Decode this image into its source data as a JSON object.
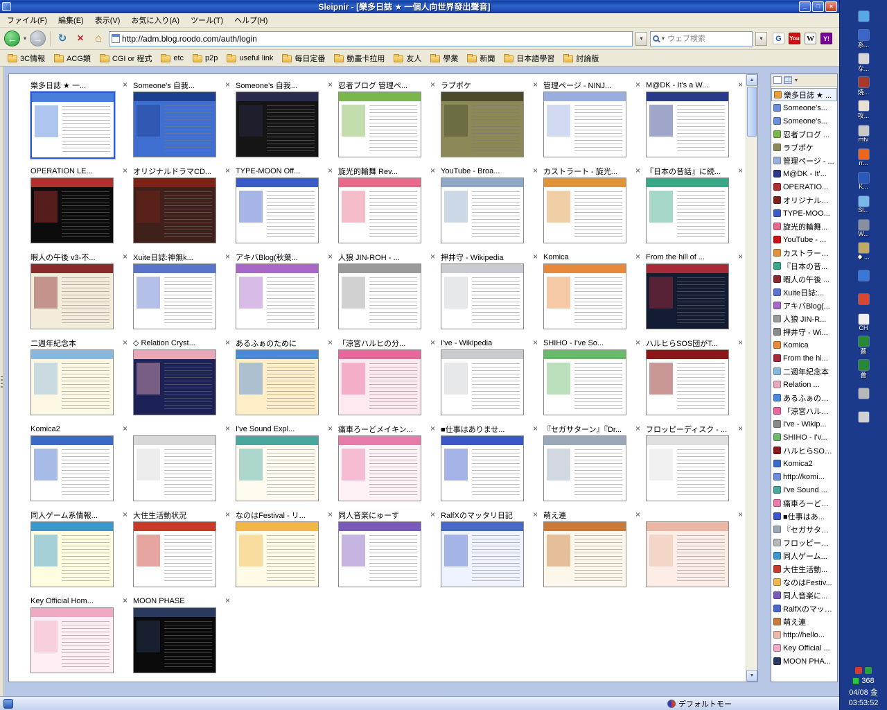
{
  "icons": {
    "close": "×",
    "caret": "▾",
    "back": "←",
    "forward": "→",
    "refresh": "↻",
    "stop": "×",
    "home": "⌂",
    "minimize": "_",
    "maximize": "□",
    "close_win": "×",
    "up": "▲",
    "down": "▼",
    "google": "G",
    "youtube": "You",
    "wikipedia": "W",
    "yahoo": "Y!"
  },
  "titlebar": {
    "title": "Sleipnir - [樂多日誌 ★ 一個人向世界發出聲音]"
  },
  "menu": {
    "items": [
      {
        "label": "ファイル(F)"
      },
      {
        "label": "編集(E)"
      },
      {
        "label": "表示(V)"
      },
      {
        "label": "お気に入り(A)"
      },
      {
        "label": "ツール(T)"
      },
      {
        "label": "ヘルプ(H)"
      }
    ]
  },
  "toolbar": {
    "address": "http://adm.blog.roodo.com/auth/login",
    "search_placeholder": "ウェブ検索"
  },
  "linksbar": {
    "items": [
      {
        "label": "3C情報"
      },
      {
        "label": "ACG類"
      },
      {
        "label": "CGI or 程式"
      },
      {
        "label": "etc"
      },
      {
        "label": "p2p"
      },
      {
        "label": "useful link"
      },
      {
        "label": "每日定番"
      },
      {
        "label": "動畫卡拉用"
      },
      {
        "label": "友人"
      },
      {
        "label": "學業"
      },
      {
        "label": "新聞"
      },
      {
        "label": "日本語學習"
      },
      {
        "label": "討論版"
      }
    ]
  },
  "thumbs": [
    {
      "title": "樂多日誌 ★ 一...",
      "c1": "#ffffff",
      "c2": "#4a7edb",
      "sel": true
    },
    {
      "title": "Someone's 自我...",
      "c1": "#3f6fd0",
      "c2": "#1d3f8f"
    },
    {
      "title": "Someone's 自我...",
      "c1": "#151515",
      "c2": "#2a2a4a"
    },
    {
      "title": "忍者ブログ 管理ペ...",
      "c1": "#ffffff",
      "c2": "#7ab648"
    },
    {
      "title": "ラブポケ",
      "c1": "#8a8a58",
      "c2": "#4a4a2a"
    },
    {
      "title": "管理ページ - NINJ...",
      "c1": "#ffffff",
      "c2": "#9aaede"
    },
    {
      "title": "M@DK - It's a W...",
      "c1": "#ffffff",
      "c2": "#2a3a8a"
    },
    {
      "title": "OPERATION LE...",
      "c1": "#0c0c0c",
      "c2": "#b03030"
    },
    {
      "title": "オリジナルドラマCD...",
      "c1": "#40201a",
      "c2": "#7a2418"
    },
    {
      "title": "TYPE-MOON Off...",
      "c1": "#ffffff",
      "c2": "#3a5cc8"
    },
    {
      "title": "旋光的輪舞 Rev...",
      "c1": "#ffffff",
      "c2": "#e86a8a"
    },
    {
      "title": "YouTube - Broa...",
      "c1": "#ffffff",
      "c2": "#90a8c8"
    },
    {
      "title": "カストラート - 旋光...",
      "c1": "#ffffff",
      "c2": "#e0943a"
    },
    {
      "title": "『日本の昔話』に続...",
      "c1": "#ffffff",
      "c2": "#3aa888"
    },
    {
      "title": "暇人の午後 v3-不...",
      "c1": "#f2ecda",
      "c2": "#8a2a2a"
    },
    {
      "title": "Xuite日誌:神無k...",
      "c1": "#ffffff",
      "c2": "#5a74cc"
    },
    {
      "title": "アキバBlog(秋葉...",
      "c1": "#ffffff",
      "c2": "#a868c8"
    },
    {
      "title": "人狼 JIN-ROH - ...",
      "c1": "#ffffff",
      "c2": "#9a9a9a"
    },
    {
      "title": "押井守 - Wikipedia",
      "c1": "#ffffff",
      "c2": "#c8ccd1"
    },
    {
      "title": "Komica",
      "c1": "#ffffff",
      "c2": "#e8883a"
    },
    {
      "title": "From the hill of ...",
      "c1": "#141c34",
      "c2": "#a82a38"
    },
    {
      "title": "二週年紀念本",
      "c1": "#fdf8e4",
      "c2": "#8ab8dc"
    },
    {
      "title": "◇ Relation Cryst...",
      "c1": "#1c2256",
      "c2": "#e8a8b8"
    },
    {
      "title": "あるふぁのために",
      "c1": "#ffeec8",
      "c2": "#4a88d8"
    },
    {
      "title": "「涼宮ハルヒの分...",
      "c1": "#ffe9f1",
      "c2": "#e8679a"
    },
    {
      "title": "I've - Wikipedia",
      "c1": "#ffffff",
      "c2": "#c8ccd1"
    },
    {
      "title": "SHIHO - I've So...",
      "c1": "#ffffff",
      "c2": "#6ab86a"
    },
    {
      "title": "ハルヒらSOS団がT...",
      "c1": "#ffffff",
      "c2": "#8a1818"
    },
    {
      "title": "Komica2",
      "c1": "#ffffff",
      "c2": "#3a6ac8"
    },
    {
      "title": "",
      "c1": "#ffffff",
      "c2": "#d8d8d8"
    },
    {
      "title": "I've Sound Expl...",
      "c1": "#fffbee",
      "c2": "#48a8a0"
    },
    {
      "title": "痛車ろーどメイキン...",
      "c1": "#fff2f6",
      "c2": "#e87aaa"
    },
    {
      "title": "■仕事はありませ...",
      "c1": "#ffffff",
      "c2": "#3a56c8"
    },
    {
      "title": "『セガサターン』『Dr...",
      "c1": "#ffffff",
      "c2": "#9aa8b8"
    },
    {
      "title": "フロッピーディスク - ...",
      "c1": "#ffffff",
      "c2": "#e0e0e0"
    },
    {
      "title": "同人ゲーム系情報...",
      "c1": "#fffde0",
      "c2": "#3a98cc"
    },
    {
      "title": "大住生活動状況",
      "c1": "#ffffff",
      "c2": "#c83a2a"
    },
    {
      "title": "なのはFestival - リ...",
      "c1": "#fffbe6",
      "c2": "#f0b84a"
    },
    {
      "title": "同人音楽にゅーす",
      "c1": "#ffffff",
      "c2": "#7a5ab8"
    },
    {
      "title": "RalfXのマッタリ日記",
      "c1": "#eef3ff",
      "c2": "#4a68c8"
    },
    {
      "title": "萌え連",
      "c1": "#fdf6ea",
      "c2": "#c87a3a"
    },
    {
      "title": "",
      "c1": "#fceee6",
      "c2": "#eab8a4"
    },
    {
      "title": "Key Official Hom...",
      "c1": "#ffeef3",
      "c2": "#f0a8c4"
    },
    {
      "title": "MOON PHASE",
      "c1": "#0a0a0a",
      "c2": "#2a3a5e"
    }
  ],
  "sidebar": {
    "items": [
      {
        "label": "樂多日誌 ★ ...",
        "ic": "#e8a13a",
        "sel": true
      },
      {
        "label": "Someone's...",
        "ic": "#6a8fd8"
      },
      {
        "label": "Someone's...",
        "ic": "#6a8fd8"
      },
      {
        "label": "忍者ブログ ...",
        "ic": "#7ab648"
      },
      {
        "label": "ラブポケ",
        "ic": "#8a8a58"
      },
      {
        "label": "管理ページ - ...",
        "ic": "#9aaede"
      },
      {
        "label": "M@DK - It'...",
        "ic": "#2a3a8a"
      },
      {
        "label": "OPERATIO...",
        "ic": "#b03030"
      },
      {
        "label": "オリジナルドラ...",
        "ic": "#7a2418"
      },
      {
        "label": "TYPE-MOO...",
        "ic": "#3a5cc8"
      },
      {
        "label": "旋光的輪舞...",
        "ic": "#e86a8a"
      },
      {
        "label": "YouTube - ...",
        "ic": "#cc1111"
      },
      {
        "label": "カストラート -...",
        "ic": "#e0943a"
      },
      {
        "label": "『日本の昔...",
        "ic": "#3aa888"
      },
      {
        "label": "暇人の午後 ...",
        "ic": "#8a2a2a"
      },
      {
        "label": "Xuite日誌:...",
        "ic": "#5a74cc"
      },
      {
        "label": "アキバBlog(...",
        "ic": "#a868c8"
      },
      {
        "label": "人狼 JIN-R...",
        "ic": "#9a9a9a"
      },
      {
        "label": "押井守 - Wi...",
        "ic": "#8a8a8a"
      },
      {
        "label": "Komica",
        "ic": "#e8883a"
      },
      {
        "label": "From the hi...",
        "ic": "#a82a38"
      },
      {
        "label": "二週年紀念本",
        "ic": "#8ab8dc"
      },
      {
        "label": "Relation ...",
        "ic": "#e8a8b8"
      },
      {
        "label": "あるふぁのため...",
        "ic": "#4a88d8"
      },
      {
        "label": "「涼宮ハルヒ...",
        "ic": "#e8679a"
      },
      {
        "label": "I've - Wikip...",
        "ic": "#8a8a8a"
      },
      {
        "label": "SHIHO - I'v...",
        "ic": "#6ab86a"
      },
      {
        "label": "ハルヒらSOS...",
        "ic": "#8a1818"
      },
      {
        "label": "Komica2",
        "ic": "#3a6ac8"
      },
      {
        "label": "http://komi...",
        "ic": "#6a8fd8"
      },
      {
        "label": "I've Sound ...",
        "ic": "#48a8a0"
      },
      {
        "label": "痛車ろーどメ...",
        "ic": "#e87aaa"
      },
      {
        "label": "■仕事はあ...",
        "ic": "#3a56c8"
      },
      {
        "label": "『セガサターン...",
        "ic": "#9aa8b8"
      },
      {
        "label": "フロッピーディ...",
        "ic": "#b8b8b8"
      },
      {
        "label": "同人ゲーム...",
        "ic": "#3a98cc"
      },
      {
        "label": "大住生活動...",
        "ic": "#c83a2a"
      },
      {
        "label": "なのはFestiv...",
        "ic": "#f0b84a"
      },
      {
        "label": "同人音楽に...",
        "ic": "#7a5ab8"
      },
      {
        "label": "RalfXのマッタ...",
        "ic": "#4a68c8"
      },
      {
        "label": "萌え連",
        "ic": "#c87a3a"
      },
      {
        "label": "http://hello...",
        "ic": "#eab8a4"
      },
      {
        "label": "Key Official ...",
        "ic": "#f0a8c4"
      },
      {
        "label": "MOON PHA...",
        "ic": "#2a3a5e"
      }
    ]
  },
  "statusbar": {
    "mode": "デフォルトモー"
  },
  "desktop": {
    "icons": [
      {
        "l": "",
        "c": "#58a8e8"
      },
      {
        "l": "系...",
        "c": "#3a66c8"
      },
      {
        "l": "な...",
        "c": "#d8d8d8"
      },
      {
        "l": "焼...",
        "c": "#a83828"
      },
      {
        "l": "攻...",
        "c": "#e8e0d0"
      },
      {
        "l": "mtv",
        "c": "#c8c8c8"
      },
      {
        "l": "rr...",
        "c": "#e86820"
      },
      {
        "l": "K...",
        "c": "#2858b8"
      },
      {
        "l": "Sl...",
        "c": "#78b8e8"
      },
      {
        "l": "W...",
        "c": "#8890a0"
      },
      {
        "l": "◆ ...",
        "c": "#c0a868"
      },
      {
        "l": "",
        "c": "#3a78d8"
      },
      {
        "l": "",
        "c": "#d84830"
      },
      {
        "l": "CH",
        "c": "#f0f0f0"
      },
      {
        "l": "薔",
        "c": "#288838"
      },
      {
        "l": "薔",
        "c": "#288838"
      },
      {
        "l": "",
        "c": "#b8b8b8"
      },
      {
        "l": "",
        "c": "#d0d0d0"
      }
    ],
    "tray": {
      "count": "368",
      "date": "04/08 金",
      "time": "03:53:52"
    }
  }
}
